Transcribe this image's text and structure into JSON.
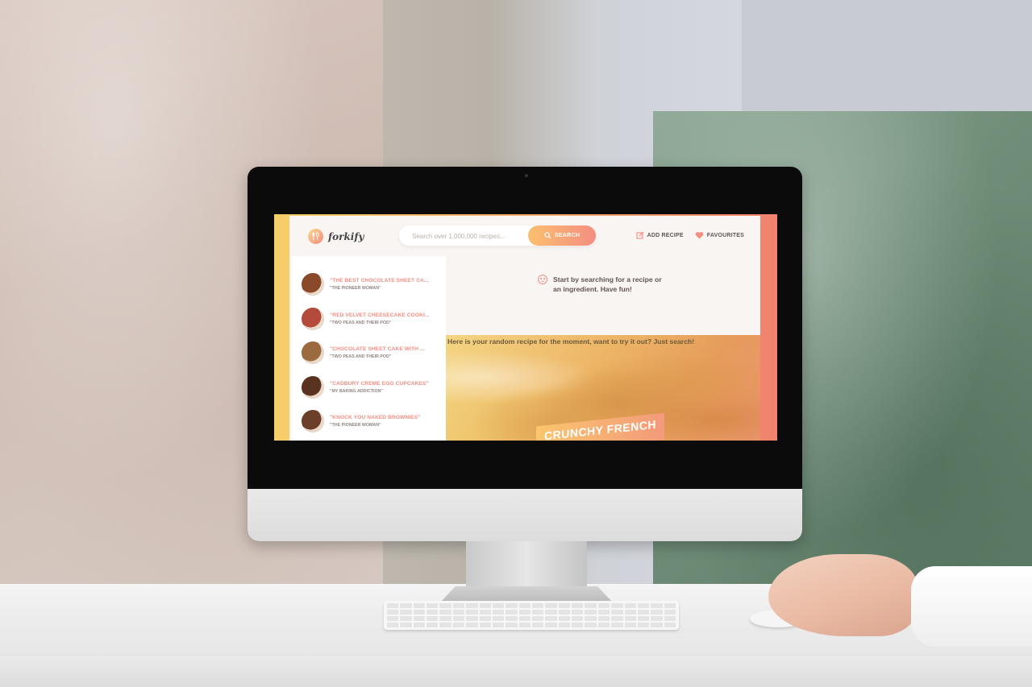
{
  "app": {
    "logo_text": "forkify",
    "search": {
      "placeholder": "Search over 1,000,000 recipes...",
      "button_label": "SEARCH"
    },
    "nav": {
      "add_recipe": "ADD RECIPE",
      "favourites": "FAVOURITES"
    },
    "results": [
      {
        "title": "\"THE BEST CHOCOLATE SHEET CA...",
        "publisher": "\"THE PIONEER WOMAN\"",
        "thumb_color": "#8a4a2a"
      },
      {
        "title": "\"RED VELVET CHEESECAKE COOKI...",
        "publisher": "\"TWO PEAS AND THEIR POD\"",
        "thumb_color": "#b44a3c"
      },
      {
        "title": "\"CHOCOLATE SHEET CAKE WITH ...",
        "publisher": "\"TWO PEAS AND THEIR POD\"",
        "thumb_color": "#9b6a3e"
      },
      {
        "title": "\"CADBURY CREME EGG CUPCAKES\"",
        "publisher": "\"MY BAKING ADDICTION\"",
        "thumb_color": "#5a3320"
      },
      {
        "title": "\"KNOCK YOU NAKED BROWNIES\"",
        "publisher": "\"THE PIONEER WOMAN\"",
        "thumb_color": "#6b3f2a"
      }
    ],
    "message": "Start by searching for a recipe or an ingredient. Have fun!",
    "random": {
      "caption": "Here is your random recipe for the moment, want to try it out? Just search!",
      "title": "CRUNCHY FRENCH"
    }
  },
  "colors": {
    "accent": "#f38e82",
    "accent_light": "#fbdb89",
    "text": "#615551"
  },
  "icons": {
    "logo": "fork-spoon-icon",
    "search": "search-icon",
    "add_recipe": "edit-icon",
    "favourites": "heart-icon",
    "message": "smile-icon"
  }
}
